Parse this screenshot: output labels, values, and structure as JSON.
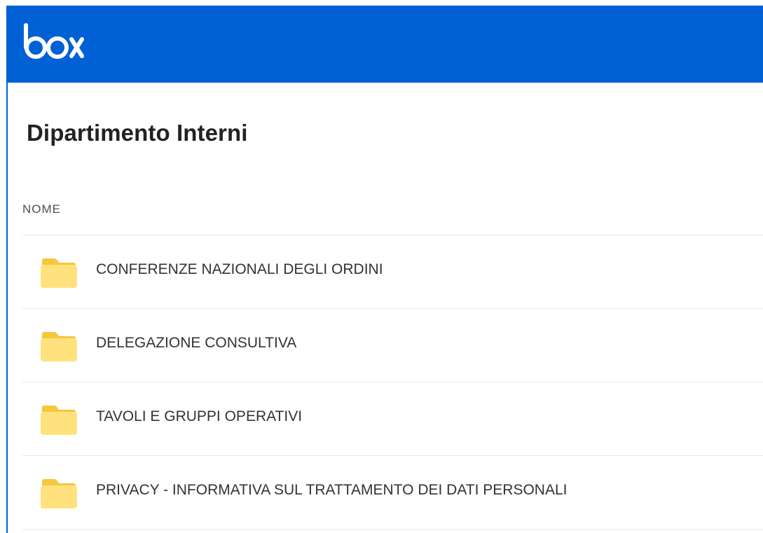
{
  "header": {
    "logo_text": "box",
    "brand_color": "#0061d5"
  },
  "page": {
    "title": "Dipartimento Interni"
  },
  "table": {
    "column_header": "NOME",
    "rows": [
      {
        "name": "CONFERENZE NAZIONALI DEGLI ORDINI",
        "icon": "folder-icon"
      },
      {
        "name": "DELEGAZIONE CONSULTIVA",
        "icon": "folder-icon"
      },
      {
        "name": "TAVOLI E GRUPPI OPERATIVI",
        "icon": "folder-icon"
      },
      {
        "name": "PRIVACY - INFORMATIVA SUL TRATTAMENTO DEI DATI PERSONALI",
        "icon": "folder-icon"
      }
    ]
  },
  "colors": {
    "folder_back": "#f5c73a",
    "folder_front": "#ffe27e"
  }
}
